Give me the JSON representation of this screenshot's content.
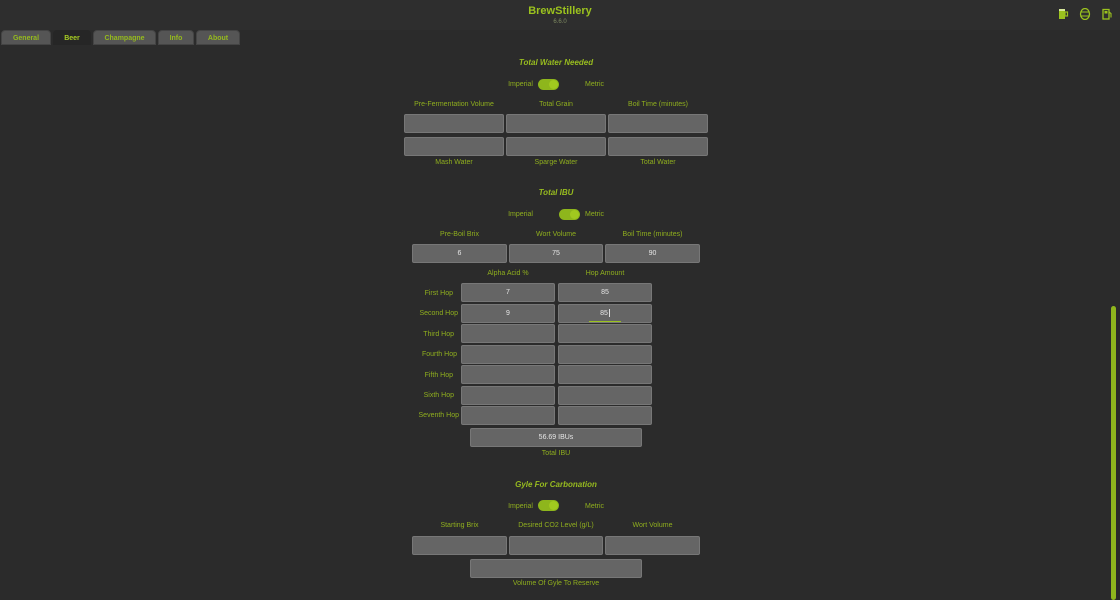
{
  "app": {
    "title": "BrewStillery",
    "version": "6.6.0"
  },
  "header_icons": [
    "beer-mug-icon",
    "barrel-icon",
    "fuel-pump-icon"
  ],
  "tabs": [
    "General",
    "Beer",
    "Champagne",
    "Info",
    "About"
  ],
  "active_tab": "Beer",
  "water": {
    "title": "Total Water Needed",
    "units": {
      "left": "Imperial",
      "right": "Metric",
      "state": "metric"
    },
    "inputs": [
      {
        "label": "Pre-Fermentation Volume",
        "value": ""
      },
      {
        "label": "Total Grain",
        "value": ""
      },
      {
        "label": "Boil Time (minutes)",
        "value": ""
      }
    ],
    "outputs": [
      {
        "label": "Mash Water",
        "value": ""
      },
      {
        "label": "Sparge Water",
        "value": ""
      },
      {
        "label": "Total Water",
        "value": ""
      }
    ]
  },
  "ibu": {
    "title": "Total IBU",
    "units": {
      "left": "Imperial",
      "right": "Metric",
      "state": "metric"
    },
    "inputs": [
      {
        "label": "Pre-Boil Brix",
        "value": "6"
      },
      {
        "label": "Wort Volume",
        "value": "75"
      },
      {
        "label": "Boil Time (minutes)",
        "value": "90"
      }
    ],
    "col_alpha": "Alpha Acid %",
    "col_amount": "Hop Amount",
    "hops": [
      {
        "label": "First Hop",
        "alpha": "7",
        "amount": "85"
      },
      {
        "label": "Second Hop",
        "alpha": "9",
        "amount": "85"
      },
      {
        "label": "Third Hop",
        "alpha": "",
        "amount": ""
      },
      {
        "label": "Fourth Hop",
        "alpha": "",
        "amount": ""
      },
      {
        "label": "Fifth Hop",
        "alpha": "",
        "amount": ""
      },
      {
        "label": "Sixth Hop",
        "alpha": "",
        "amount": ""
      },
      {
        "label": "Seventh Hop",
        "alpha": "",
        "amount": ""
      }
    ],
    "result": {
      "value": "56.69 IBUs",
      "label": "Total IBU"
    }
  },
  "gyle": {
    "title": "Gyle For Carbonation",
    "units": {
      "left": "Imperial",
      "right": "Metric",
      "state": "metric"
    },
    "inputs": [
      {
        "label": "Starting Brix",
        "value": ""
      },
      {
        "label": "Desired CO2 Level (g/L)",
        "value": ""
      },
      {
        "label": "Wort Volume",
        "value": ""
      }
    ],
    "result": {
      "value": "",
      "label": "Volume Of Gyle To Reserve"
    }
  },
  "colors": {
    "accent": "#8fb61d",
    "background": "#2b2b2b",
    "field": "#656565"
  }
}
